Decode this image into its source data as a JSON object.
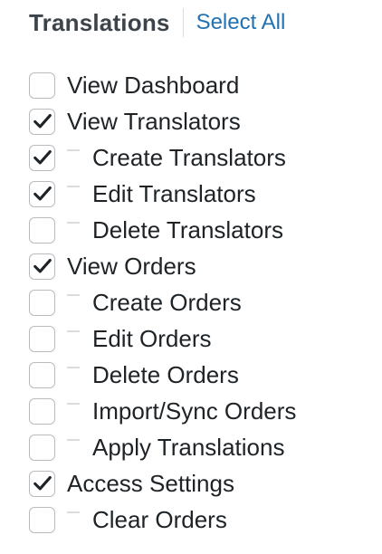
{
  "header": {
    "title": "Translations",
    "select_all": "Select All"
  },
  "permissions": [
    {
      "label": "View Dashboard",
      "checked": false,
      "child": false
    },
    {
      "label": "View Translators",
      "checked": true,
      "child": false
    },
    {
      "label": "Create Translators",
      "checked": true,
      "child": true
    },
    {
      "label": "Edit Translators",
      "checked": true,
      "child": true
    },
    {
      "label": "Delete Translators",
      "checked": false,
      "child": true
    },
    {
      "label": "View Orders",
      "checked": true,
      "child": false
    },
    {
      "label": "Create Orders",
      "checked": false,
      "child": true
    },
    {
      "label": "Edit Orders",
      "checked": false,
      "child": true
    },
    {
      "label": "Delete Orders",
      "checked": false,
      "child": true
    },
    {
      "label": "Import/Sync Orders",
      "checked": false,
      "child": true
    },
    {
      "label": "Apply Translations",
      "checked": false,
      "child": true
    },
    {
      "label": "Access Settings",
      "checked": true,
      "child": false
    },
    {
      "label": "Clear Orders",
      "checked": false,
      "child": true
    }
  ],
  "colors": {
    "link": "#2271b1",
    "check": "#1d2327",
    "checkbox_border": "#b8bcc0"
  }
}
